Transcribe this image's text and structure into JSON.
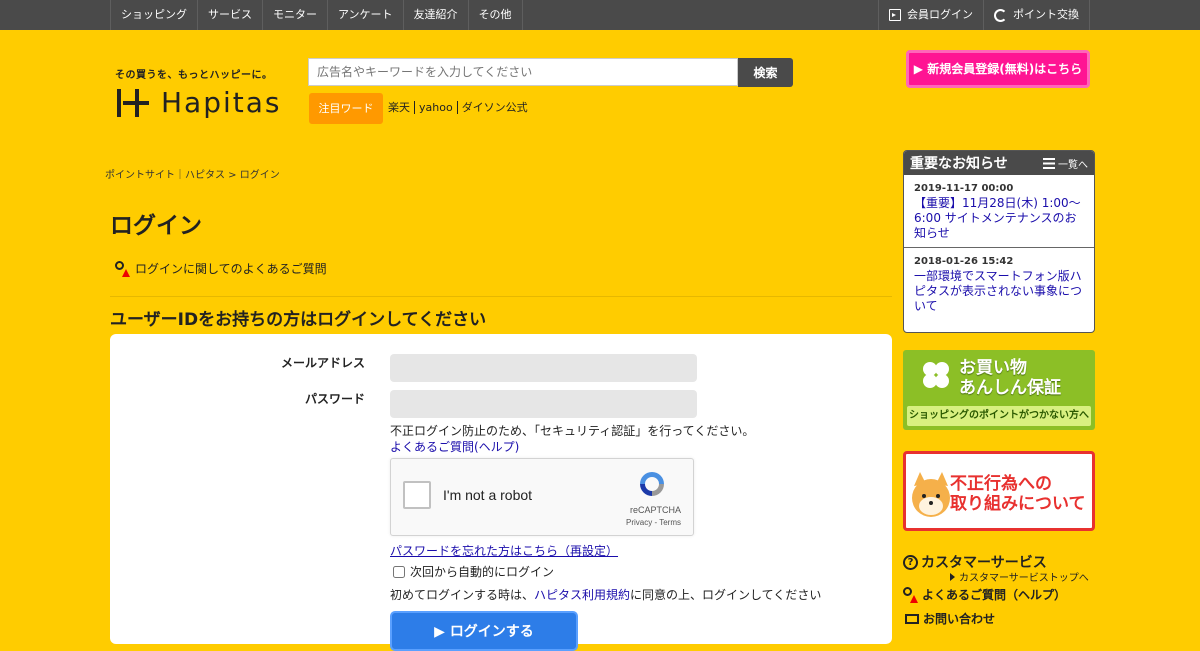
{
  "topnav": {
    "items": [
      "ショッピング",
      "サービス",
      "モニター",
      "アンケート",
      "友達紹介",
      "その他"
    ],
    "login_label": "会員ログイン",
    "exchange_label": "ポイント交換"
  },
  "header": {
    "tagline": "その買うを、もっとハッピーに。",
    "logo_text": "Hapitas",
    "search_placeholder": "広告名やキーワードを入力してください",
    "search_button": "検索",
    "hotword_label": "注目ワード",
    "hotwords": [
      "楽天",
      "yahoo",
      "ダイソン公式"
    ],
    "register_button": "▶ 新規会員登録(無料)はこちら"
  },
  "breadcrumb": "ポイントサイト｜ハピタス > ログイン",
  "page_title": "ログイン",
  "faq_link": "ログインに関してのよくあるご質問",
  "section_title": "ユーザーIDをお持ちの方はログインしてください",
  "login_form": {
    "email_label": "メールアドレス",
    "password_label": "パスワード",
    "email_value": "",
    "password_value": "",
    "security_note": "不正ログイン防止のため、「セキュリティ認証」を行ってください。",
    "help_link": "よくあるご質問(ヘルプ)",
    "captcha_text": "I'm not a robot",
    "captcha_brand": "reCAPTCHA",
    "captcha_legal": "Privacy - Terms",
    "forgot_link": "パスワードを忘れた方はこちら（再設定）",
    "remember_label": "次回から自動的にログイン",
    "terms_prefix": "初めてログインする時は、",
    "terms_link": "ハピタス利用規約",
    "terms_suffix": "に同意の上、ログインしてください",
    "login_button": "▶ ログインする"
  },
  "sidebar": {
    "notice_title": "重要なお知らせ",
    "notice_more": "一覧へ",
    "notices": [
      {
        "date": "2019-11-17 00:00",
        "text": "【重要】11月28日(木) 1:00～6:00 サイトメンテナンスのお知らせ"
      },
      {
        "date": "2018-01-26 15:42",
        "text": "一部環境でスマートフォン版ハピタスが表示されない事象について"
      }
    ],
    "shop_banner_title": "お買い物\nあんしん保証",
    "shop_banner_sub": "ショッピングのポイントがつかない方へ",
    "fraud_banner_text": "不正行為への\n取り組みについて",
    "cs_title": "カスタマーサービス",
    "cs_top": "カスタマーサービストップへ",
    "cs_faq": "よくあるご質問（ヘルプ）",
    "cs_contact": "お問い合わせ"
  }
}
